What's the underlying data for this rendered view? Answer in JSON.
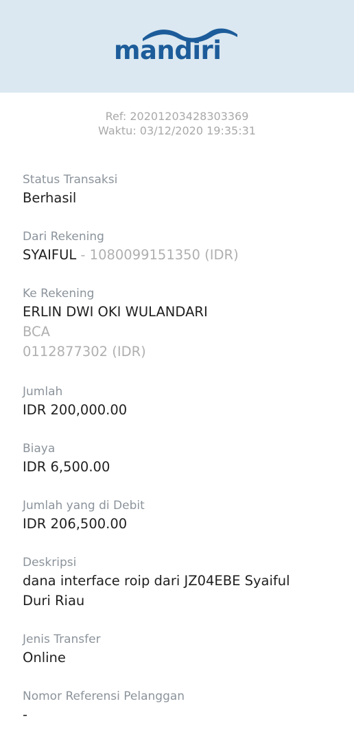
{
  "brand": {
    "name": "mandiri",
    "color": "#1d5c9a",
    "header_bg": "#dbe8f1"
  },
  "receipt": {
    "ref": "Ref: 20201203428303369",
    "time": "Waktu: 03/12/2020 19:35:31"
  },
  "fields": {
    "status": {
      "label": "Status Transaksi",
      "value": "Berhasil"
    },
    "from": {
      "label": "Dari Rekening",
      "name": "SYAIFUL",
      "separator": " - ",
      "account": "1080099151350 (IDR)"
    },
    "to": {
      "label": "Ke Rekening",
      "name": "ERLIN DWI OKI WULANDARI",
      "bank": "BCA",
      "account": "0112877302 (IDR)"
    },
    "amount": {
      "label": "Jumlah",
      "value": "IDR 200,000.00"
    },
    "fee": {
      "label": "Biaya",
      "value": "IDR 6,500.00"
    },
    "debited": {
      "label": "Jumlah yang di Debit",
      "value": "IDR 206,500.00"
    },
    "description": {
      "label": "Deskripsi",
      "value": "dana interface roip dari JZ04EBE Syaiful Duri Riau"
    },
    "transfer_type": {
      "label": "Jenis Transfer",
      "value": "Online"
    },
    "customer_ref": {
      "label": "Nomor Referensi Pelanggan",
      "value": "-"
    }
  }
}
